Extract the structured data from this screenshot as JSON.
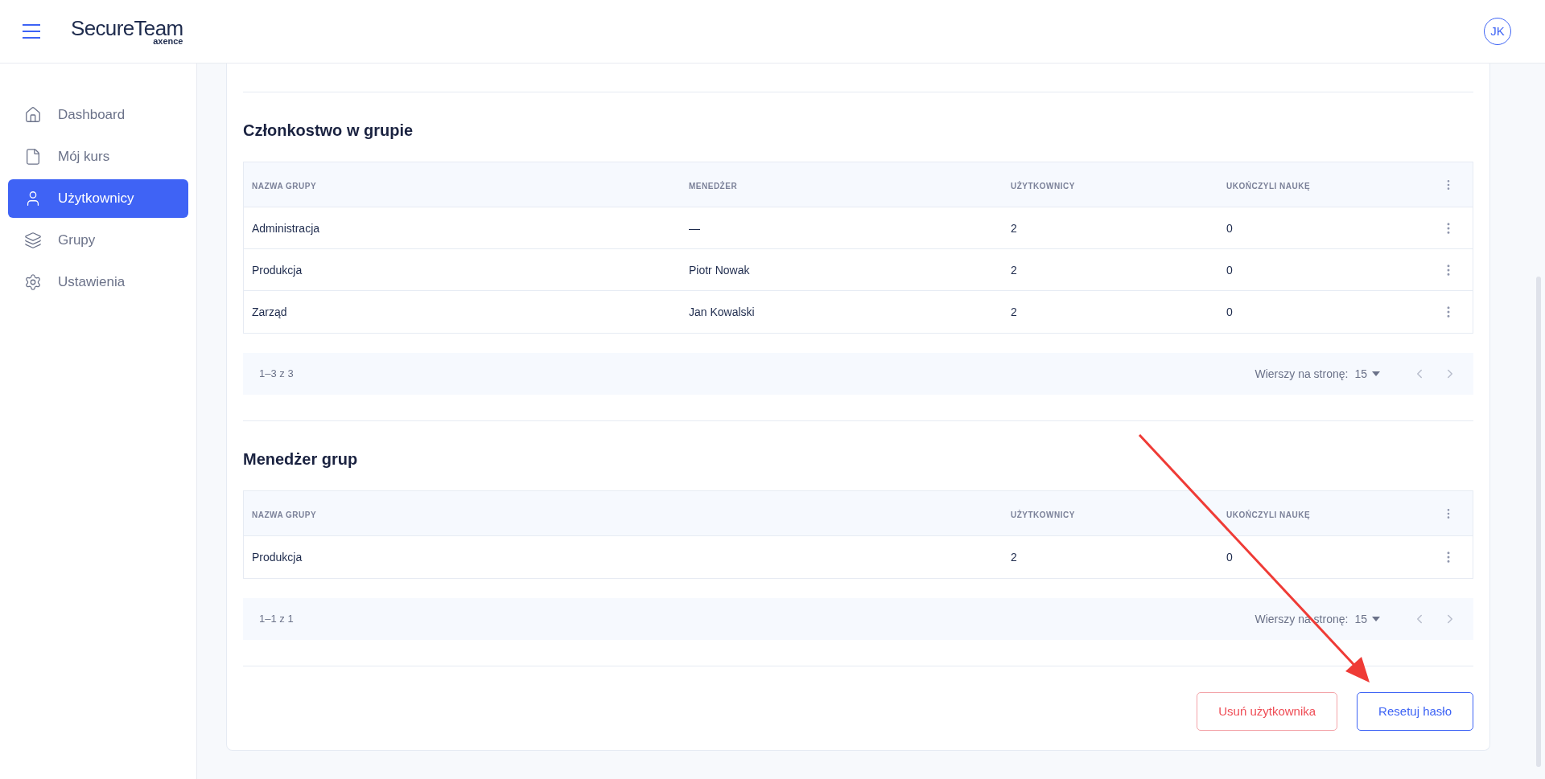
{
  "header": {
    "logo_main": "SecureTeam",
    "logo_sub": "axence",
    "avatar": "JK"
  },
  "sidebar": {
    "items": [
      {
        "label": "Dashboard",
        "selected": false
      },
      {
        "label": "Mój kurs",
        "selected": false
      },
      {
        "label": "Użytkownicy",
        "selected": true
      },
      {
        "label": "Grupy",
        "selected": false
      },
      {
        "label": "Ustawienia",
        "selected": false
      }
    ]
  },
  "sections": [
    {
      "title": "Członkostwo w grupie",
      "columns": [
        {
          "label": "NAZWA GRUPY",
          "kind": "name"
        },
        {
          "label": "MENEDŻER",
          "kind": "manager"
        },
        {
          "label": "UŻYTKOWNICY",
          "kind": "users"
        },
        {
          "label": "UKOŃCZYLI NAUKĘ",
          "kind": "done"
        }
      ],
      "rows": [
        {
          "cells": [
            "Administracja",
            "—",
            "2",
            "0"
          ]
        },
        {
          "cells": [
            "Produkcja",
            "Piotr Nowak",
            "2",
            "0"
          ]
        },
        {
          "cells": [
            "Zarząd",
            "Jan Kowalski",
            "2",
            "0"
          ]
        }
      ],
      "pagination": {
        "range": "1–3 z 3",
        "rows_per_page_label": "Wierszy na stronę:",
        "rows_per_page": "15"
      }
    },
    {
      "title": "Menedżer grup",
      "columns": [
        {
          "label": "NAZWA GRUPY",
          "kind": "name"
        },
        {
          "label": "UŻYTKOWNICY",
          "kind": "users"
        },
        {
          "label": "UKOŃCZYLI NAUKĘ",
          "kind": "done"
        }
      ],
      "rows": [
        {
          "cells": [
            "Produkcja",
            "2",
            "0"
          ]
        }
      ],
      "pagination": {
        "range": "1–1 z 1",
        "rows_per_page_label": "Wierszy na stronę:",
        "rows_per_page": "15"
      }
    }
  ],
  "buttons": [
    {
      "label": "Usuń użytkownika",
      "kind": "danger"
    },
    {
      "label": "Resetuj hasło",
      "kind": "primary"
    }
  ]
}
